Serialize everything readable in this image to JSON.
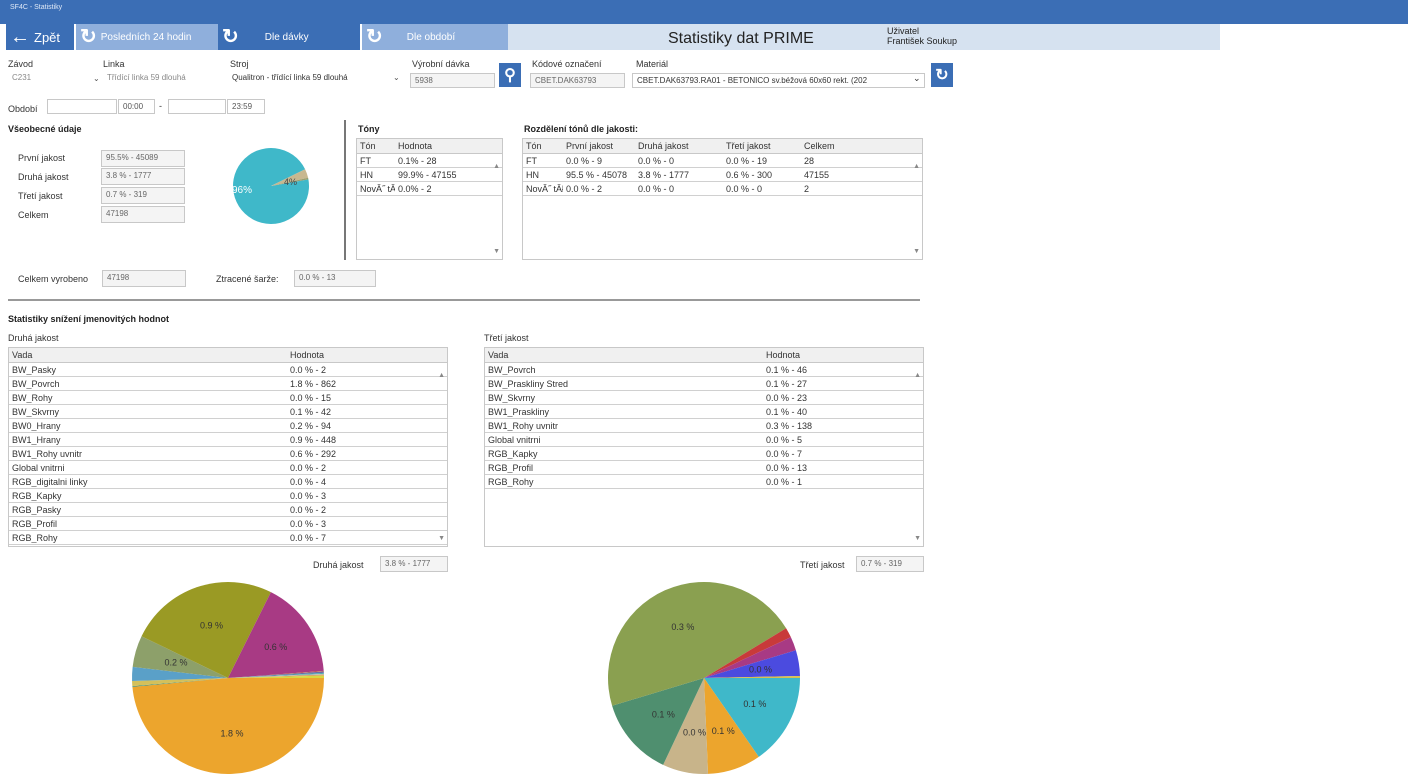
{
  "app_title": "SF4C - Statistiky",
  "toolbar": {
    "back_label": "Zpět",
    "last24_label": "Posledních 24 hodin",
    "batch_label": "Dle dávky",
    "period_label": "Dle období"
  },
  "page_title": "Statistiky dat PRIME",
  "user": {
    "label": "Uživatel",
    "name": "František Soukup"
  },
  "filters": {
    "plant_label": "Závod",
    "plant_value": "C231",
    "line_label": "Linka",
    "line_value": "Třídící linka 59 dlouhá",
    "machine_label": "Stroj",
    "machine_value": "Qualitron - třídící linka 59 dlouhá",
    "batch_label": "Výrobní dávka",
    "batch_value": "5938",
    "code_label": "Kódové označení",
    "code_value": "CBET.DAK63793",
    "material_label": "Materiál",
    "material_value": "CBET.DAK63793.RA01 - BETONICO sv.béžová 60x60 rekt. (202",
    "period_label": "Období",
    "period_from_date": "",
    "period_from_time": "00:00",
    "period_sep": "-",
    "period_to_date": "",
    "period_to_time": "23:59"
  },
  "general": {
    "title": "Všeobecné údaje",
    "first_label": "První jakost",
    "first_value": "95.5% - 45089",
    "second_label": "Druhá jakost",
    "second_value": "3.8 % - 1777",
    "third_label": "Třetí jakost",
    "third_value": "0.7 % - 319",
    "total_label": "Celkem",
    "total_value": "47198",
    "produced_label": "Celkem vyrobeno",
    "produced_value": "47198",
    "lost_label": "Ztracené šarže:",
    "lost_value": "0.0 % - 13",
    "pie_labels": [
      "96%",
      "4%"
    ],
    "pie_values": [
      95.5,
      3.8,
      0.7
    ],
    "pie_colors": [
      "#3fb8c9",
      "#c8b890",
      "#9aa070"
    ]
  },
  "tones": {
    "title": "Tóny",
    "headers": [
      "Tón",
      "Hodnota"
    ],
    "rows": [
      [
        "FT",
        "0.1% - 28"
      ],
      [
        "HN",
        "99.9% - 47155"
      ],
      [
        "NovĂ˝ tĂłn",
        "0.0% - 2"
      ]
    ]
  },
  "tone_quality": {
    "title": "Rozdělení tónů dle jakosti:",
    "headers": [
      "Tón",
      "První jakost",
      "Druhá jakost",
      "Třetí jakost",
      "Celkem"
    ],
    "rows": [
      [
        "FT",
        "0.0 % - 9",
        "0.0 % - 0",
        "0.0 % - 19",
        "28"
      ],
      [
        "HN",
        "95.5 % - 45078",
        "3.8 % - 1777",
        "0.6 % - 300",
        "47155"
      ],
      [
        "NovĂ˝ tĂłn",
        "0.0 % - 2",
        "0.0 % - 0",
        "0.0 % - 0",
        "2"
      ]
    ]
  },
  "reduction": {
    "title": "Statistiky snížení jmenovitých hodnot",
    "second": {
      "title": "Druhá jakost",
      "headers": [
        "Vada",
        "Hodnota"
      ],
      "rows": [
        [
          "BW_Pasky",
          "0.0 % - 2"
        ],
        [
          "BW_Povrch",
          "1.8 % - 862"
        ],
        [
          "BW_Rohy",
          "0.0 % - 15"
        ],
        [
          "BW_Skvrny",
          "0.1 % - 42"
        ],
        [
          "BW0_Hrany",
          "0.2 % - 94"
        ],
        [
          "BW1_Hrany",
          "0.9 % - 448"
        ],
        [
          "BW1_Rohy uvnitr",
          "0.6 % - 292"
        ],
        [
          "Global vnitrni",
          "0.0 % - 2"
        ],
        [
          "RGB_digitalni linky",
          "0.0 % - 4"
        ],
        [
          "RGB_Kapky",
          "0.0 % - 3"
        ],
        [
          "RGB_Pasky",
          "0.0 % - 2"
        ],
        [
          "RGB_Profil",
          "0.0 % - 3"
        ],
        [
          "RGB_Rohy",
          "0.0 % - 7"
        ]
      ],
      "summary_label": "Druhá jakost",
      "summary_value": "3.8 % - 1777"
    },
    "third": {
      "title": "Třetí jakost",
      "headers": [
        "Vada",
        "Hodnota"
      ],
      "rows": [
        [
          "BW_Povrch",
          "0.1 % - 46"
        ],
        [
          "BW_Praskliny Stred",
          "0.1 % - 27"
        ],
        [
          "BW_Skvrny",
          "0.0 % - 23"
        ],
        [
          "BW1_Praskliny",
          "0.1 % - 40"
        ],
        [
          "BW1_Rohy uvnitr",
          "0.3 % - 138"
        ],
        [
          "Global vnitrni",
          "0.0 % - 5"
        ],
        [
          "RGB_Kapky",
          "0.0 % - 7"
        ],
        [
          "RGB_Profil",
          "0.0 % - 13"
        ],
        [
          "RGB_Rohy",
          "0.0 % - 1"
        ]
      ],
      "summary_label": "Třetí jakost",
      "summary_value": "0.7 % - 319"
    }
  },
  "pies": {
    "second": {
      "values": [
        862,
        2,
        15,
        42,
        94,
        448,
        292,
        2,
        4,
        3,
        2,
        3,
        7
      ],
      "colors": [
        "#eca52d",
        "#3a8f7e",
        "#d4c05a",
        "#5aa0c8",
        "#8da06a",
        "#9a9a24",
        "#a83a84",
        "#c86a3a",
        "#6a6aa8",
        "#4ab0b0",
        "#b8b8b8",
        "#d49a5a",
        "#d8d840"
      ],
      "labels": [
        "1.8 %",
        "",
        "",
        "",
        "0.2 %",
        "0.9 %",
        "0.6 %",
        "",
        "",
        "",
        "",
        "",
        ""
      ]
    },
    "third": {
      "values": [
        46,
        27,
        23,
        40,
        138,
        5,
        7,
        13,
        1
      ],
      "colors": [
        "#3fb8c9",
        "#eca52d",
        "#c8b48a",
        "#4f8f6f",
        "#8aa050",
        "#c83a3a",
        "#a83a84",
        "#4b4bdf",
        "#d8c050"
      ],
      "labels": [
        "0.1 %",
        "0.1 %",
        "0.0 %",
        "0.1 %",
        "0.3 %",
        "",
        "",
        "0.0 %",
        ""
      ]
    }
  }
}
